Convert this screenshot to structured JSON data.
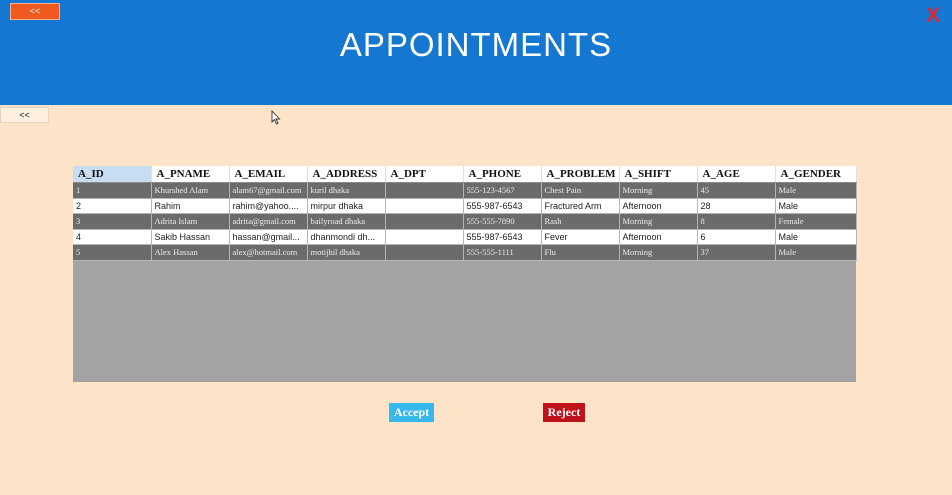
{
  "header": {
    "back_label": "<<",
    "title": "APPOINTMENTS",
    "close_label": "X"
  },
  "back2_label": "<<",
  "table": {
    "columns": [
      "A_ID",
      "A_PNAME",
      "A_EMAIL",
      "A_ADDRESS",
      "A_DPT",
      "A_PHONE",
      "A_PROBLEM",
      "A_SHIFT",
      "A_AGE",
      "A_GENDER"
    ],
    "rows": [
      [
        "1",
        "Khurshed Alam",
        "alam67@gmail.com",
        "kuril dhaka",
        "",
        "555-123-4567",
        "Chest Pain",
        "Morning",
        "45",
        "Male"
      ],
      [
        "2",
        "Rahim",
        "rahim@yahoo....",
        "mirpur dhaka",
        "",
        "555-987-6543",
        "Fractured Arm",
        "Afternoon",
        "28",
        "Male"
      ],
      [
        "3",
        "Adrita Islam",
        "adrita@gmail.com",
        "bailyroad dhaka",
        "",
        "555-555-7890",
        "Rash",
        "Morning",
        "8",
        "Female"
      ],
      [
        "4",
        "Sakib Hassan",
        "hassan@gmail...",
        "dhanmondi dh...",
        "",
        "555-987-6543",
        "Fever",
        "Afternoon",
        "6",
        "Male"
      ],
      [
        "5",
        "Alex Hassan",
        "alex@hotmail.com",
        "motijhil dhaka",
        "",
        "555-555-1111",
        "Flu",
        "Morning",
        "37",
        "Male"
      ]
    ]
  },
  "buttons": {
    "accept": "Accept",
    "reject": "Reject"
  },
  "colors": {
    "header": "#1478d2",
    "background": "#fde3c7",
    "accept": "#36b8ee",
    "reject": "#c0121a",
    "close": "#e8232b"
  }
}
